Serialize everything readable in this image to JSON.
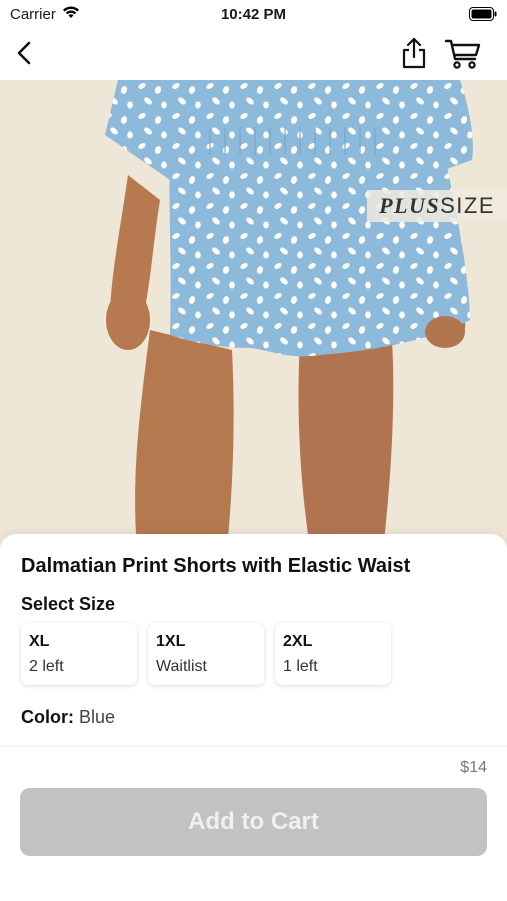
{
  "status_bar": {
    "carrier": "Carrier",
    "time": "10:42 PM",
    "icons": [
      "wifi-icon",
      "battery-icon"
    ]
  },
  "nav": {
    "icons": [
      "back-chevron-icon",
      "share-icon",
      "cart-icon"
    ]
  },
  "hero": {
    "badge_plus": "PLUS",
    "badge_size": "SIZE",
    "background_color": "#eee6d7",
    "garment_color": "#8db9da"
  },
  "product": {
    "title": "Dalmatian Print Shorts with Elastic Waist",
    "size_heading": "Select Size",
    "sizes": [
      {
        "label": "XL",
        "stock": "2 left"
      },
      {
        "label": "1XL",
        "stock": "Waitlist"
      },
      {
        "label": "2XL",
        "stock": "1 left"
      }
    ],
    "color_label": "Color:",
    "color_value": "Blue"
  },
  "footer": {
    "price": "$14",
    "add_to_cart": "Add to Cart",
    "button_color": "#c2c2c2"
  }
}
